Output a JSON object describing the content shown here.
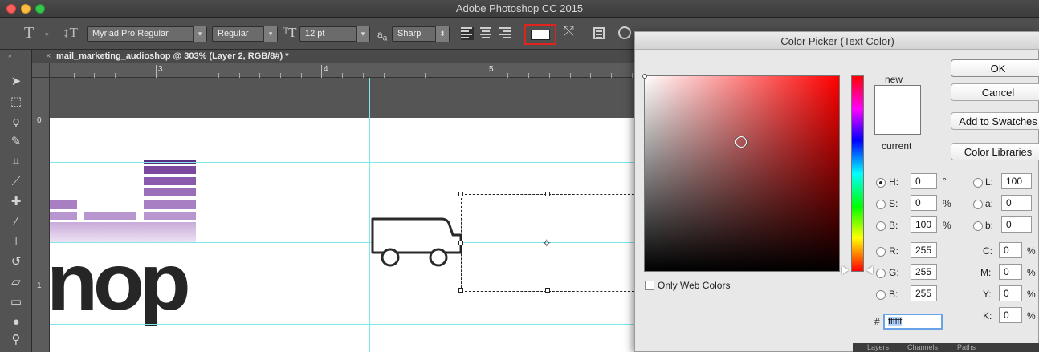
{
  "window": {
    "title": "Adobe Photoshop CC 2015"
  },
  "options_bar": {
    "font_family": "Myriad Pro Regular",
    "font_style": "Regular",
    "font_size": "12 pt",
    "antialias_icon_text": "a",
    "antialias_icon_sub": "a",
    "antialias": "Sharp",
    "text_color": "#ffffff"
  },
  "document": {
    "tab_title": "mail_marketing_audioshop @ 303% (Layer 2, RGB/8#) *",
    "ruler_top_labels": [
      "3",
      "4",
      "5"
    ],
    "ruler_left_labels": [
      "0",
      "1"
    ],
    "canvas_text": "nop"
  },
  "color_picker": {
    "title": "Color Picker (Text Color)",
    "new_label": "new",
    "current_label": "current",
    "buttons": {
      "ok": "OK",
      "cancel": "Cancel",
      "add_swatches": "Add to Swatches",
      "libraries": "Color Libraries"
    },
    "only_web_colors": "Only Web Colors",
    "hsb": [
      {
        "label": "H:",
        "value": "0",
        "unit": "°",
        "selected": true
      },
      {
        "label": "S:",
        "value": "0",
        "unit": "%",
        "selected": false
      },
      {
        "label": "B:",
        "value": "100",
        "unit": "%",
        "selected": false
      }
    ],
    "rgb": [
      {
        "label": "R:",
        "value": "255"
      },
      {
        "label": "G:",
        "value": "255"
      },
      {
        "label": "B:",
        "value": "255"
      }
    ],
    "lab": [
      {
        "label": "L:",
        "value": "100"
      },
      {
        "label": "a:",
        "value": "0"
      },
      {
        "label": "b:",
        "value": "0"
      }
    ],
    "cmyk": [
      {
        "label": "C:",
        "value": "0",
        "unit": "%"
      },
      {
        "label": "M:",
        "value": "0",
        "unit": "%"
      },
      {
        "label": "Y:",
        "value": "0",
        "unit": "%"
      },
      {
        "label": "K:",
        "value": "0",
        "unit": "%"
      }
    ],
    "hex_label": "#",
    "hex_value": "ffffff"
  },
  "bottom_panel_tabs": [
    "Layers",
    "Channels",
    "Paths"
  ]
}
